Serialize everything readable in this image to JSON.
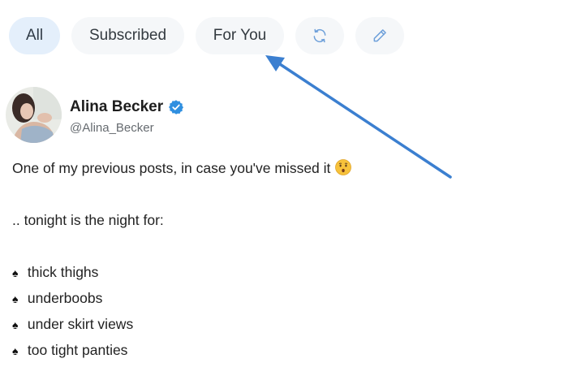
{
  "tabs": [
    {
      "label": "All",
      "active": true
    },
    {
      "label": "Subscribed",
      "active": false
    },
    {
      "label": "For You",
      "active": false
    }
  ],
  "tab_icons": [
    "refresh-icon",
    "pencil-icon"
  ],
  "colors": {
    "accent": "#3b82d6",
    "active_tab_bg": "#e4effb",
    "tab_bg": "#f5f7f9",
    "verified": "#2f8fe0"
  },
  "post": {
    "author": {
      "name": "Alina Becker",
      "handle": "@Alina_Becker",
      "verified": true
    },
    "lines": [
      "One of my previous posts, in case you've missed it",
      "",
      ".. tonight is the night for:",
      ""
    ],
    "emoji": "kissing-face-icon",
    "bullet_symbol": "♠",
    "bullets": [
      "thick thighs",
      "underboobs",
      "under skirt views",
      "too tight panties"
    ]
  }
}
